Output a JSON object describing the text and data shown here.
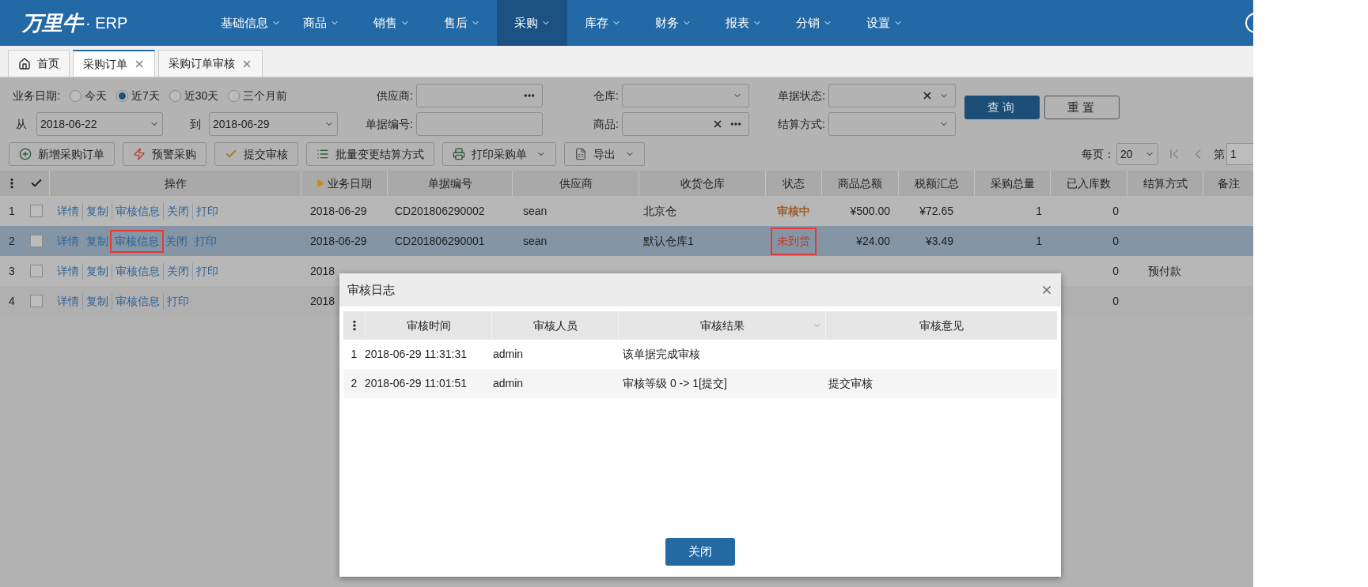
{
  "nav": {
    "logo": "万里牛",
    "logo_suffix": "· ERP",
    "menu": [
      {
        "label": "基础信息",
        "selected": false
      },
      {
        "label": "商品",
        "selected": false
      },
      {
        "label": "销售",
        "selected": false
      },
      {
        "label": "售后",
        "selected": false
      },
      {
        "label": "采购",
        "selected": true
      },
      {
        "label": "库存",
        "selected": false
      },
      {
        "label": "财务",
        "selected": false
      },
      {
        "label": "报表",
        "selected": false
      },
      {
        "label": "分销",
        "selected": false
      },
      {
        "label": "设置",
        "selected": false
      }
    ]
  },
  "tabs": [
    {
      "label": "首页",
      "kind": "home",
      "selected": false,
      "closable": false
    },
    {
      "label": "采购订单",
      "kind": "page",
      "selected": true,
      "closable": true
    },
    {
      "label": "采购订单审核",
      "kind": "page",
      "selected": false,
      "closable": true
    }
  ],
  "filters": {
    "date_label": "业务日期:",
    "date_options": [
      {
        "label": "今天",
        "selected": false
      },
      {
        "label": "近7天",
        "selected": true
      },
      {
        "label": "近30天",
        "selected": false
      },
      {
        "label": "三个月前",
        "selected": false
      }
    ],
    "supplier": {
      "label": "供应商:"
    },
    "warehouse": {
      "label": "仓库:"
    },
    "doc_status": {
      "label": "单据状态:"
    },
    "from": {
      "label": "从",
      "value": "2018-06-22"
    },
    "to": {
      "label": "到",
      "value": "2018-06-29"
    },
    "doc_no": {
      "label": "单据编号:"
    },
    "product": {
      "label": "商品:"
    },
    "settlement": {
      "label": "结算方式:"
    },
    "buttons": [
      {
        "label": "查询",
        "kind": "primary"
      },
      {
        "label": "重置",
        "kind": "secondary"
      }
    ]
  },
  "toolbar": {
    "buttons": [
      {
        "label": "新增采购订单",
        "kind": "add",
        "dropdown": false
      },
      {
        "label": "预警采购",
        "kind": "alert",
        "dropdown": false
      },
      {
        "label": "提交审核",
        "kind": "submit",
        "dropdown": false
      },
      {
        "label": "批量变更结算方式",
        "kind": "batch",
        "dropdown": false
      },
      {
        "label": "打印采购单",
        "kind": "print",
        "dropdown": true
      },
      {
        "label": "导出",
        "kind": "export",
        "dropdown": true
      }
    ],
    "pager": {
      "per_page_label": "每页：",
      "per_page": "20",
      "page_label": "第",
      "page": "1"
    }
  },
  "table": {
    "columns": [
      {
        "label": "操作",
        "sorted": false
      },
      {
        "label": "业务日期",
        "sorted": true
      },
      {
        "label": "单据编号",
        "sorted": false
      },
      {
        "label": "供应商",
        "sorted": false
      },
      {
        "label": "收货仓库",
        "sorted": false
      },
      {
        "label": "状态",
        "sorted": false
      },
      {
        "label": "商品总额",
        "sorted": false
      },
      {
        "label": "税额汇总",
        "sorted": false
      },
      {
        "label": "采购总量",
        "sorted": false
      },
      {
        "label": "已入库数",
        "sorted": false
      },
      {
        "label": "结算方式",
        "sorted": false
      },
      {
        "label": "备注",
        "sorted": false
      }
    ],
    "rows": [
      {
        "index": "1",
        "checked": false,
        "selected": false,
        "actions": [
          {
            "label": "详情",
            "highlighted": false
          },
          {
            "label": "复制",
            "highlighted": false
          },
          {
            "label": "审核信息",
            "highlighted": false
          },
          {
            "label": "关闭",
            "highlighted": false
          },
          {
            "label": "打印",
            "highlighted": false
          }
        ],
        "date": "2018-06-29",
        "doc_no": "CD201806290002",
        "supplier": "sean",
        "warehouse": "北京仓",
        "status": {
          "label": "审核中",
          "kind": "pending",
          "highlighted": false
        },
        "amount": "¥500.00",
        "tax": "¥72.65",
        "qty": "1",
        "received": "0"
      },
      {
        "index": "2",
        "checked": false,
        "selected": true,
        "actions": [
          {
            "label": "详情",
            "highlighted": false
          },
          {
            "label": "复制",
            "highlighted": false
          },
          {
            "label": "审核信息",
            "highlighted": true
          },
          {
            "label": "关闭",
            "highlighted": false
          },
          {
            "label": "打印",
            "highlighted": false
          }
        ],
        "date": "2018-06-29",
        "doc_no": "CD201806290001",
        "supplier": "sean",
        "warehouse": "默认仓库1",
        "status": {
          "label": "未到货",
          "kind": "undelivered",
          "highlighted": true
        },
        "amount": "¥24.00",
        "tax": "¥3.49",
        "qty": "1",
        "received": "0"
      },
      {
        "index": "3",
        "checked": false,
        "selected": false,
        "actions": [
          {
            "label": "详情",
            "highlighted": false
          },
          {
            "label": "复制",
            "highlighted": false
          },
          {
            "label": "审核信息",
            "highlighted": false
          },
          {
            "label": "关闭",
            "highlighted": false
          },
          {
            "label": "打印",
            "highlighted": false
          }
        ],
        "date": "2018",
        "received": "0",
        "settlement": "预付款"
      },
      {
        "index": "4",
        "checked": false,
        "selected": false,
        "actions": [
          {
            "label": "详情",
            "highlighted": false
          },
          {
            "label": "复制",
            "highlighted": false
          },
          {
            "label": "审核信息",
            "highlighted": false
          },
          {
            "label": "打印",
            "highlighted": false
          }
        ],
        "date": "2018",
        "received": "0"
      }
    ]
  },
  "dialog": {
    "title": "审核日志",
    "columns": [
      {
        "label": "审核时间",
        "sortable": false
      },
      {
        "label": "审核人员",
        "sortable": false
      },
      {
        "label": "审核结果",
        "sortable": true
      },
      {
        "label": "审核意见",
        "sortable": false
      }
    ],
    "rows": [
      {
        "index": "1",
        "time": "2018-06-29 11:31:31",
        "user": "admin",
        "result": "该单据完成审核"
      },
      {
        "index": "2",
        "time": "2018-06-29 11:01:51",
        "user": "admin",
        "result": "审核等级 0 -> 1[提交]",
        "comment": "提交审核"
      }
    ],
    "buttons": [
      {
        "label": "关闭"
      }
    ]
  }
}
